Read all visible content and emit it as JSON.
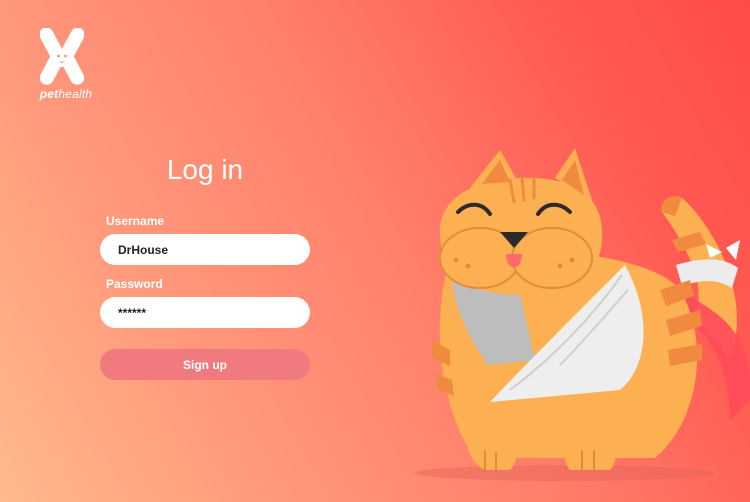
{
  "brand": {
    "name_part1": "pet",
    "name_part2": "health"
  },
  "login": {
    "title": "Log in",
    "username_label": "Username",
    "username_value": "DrHouse",
    "password_label": "Password",
    "password_value": "******",
    "submit_label": "Sign up"
  },
  "colors": {
    "accent_button": "#f07a7d",
    "gradient_start": "#ffb98a",
    "gradient_end": "#ff4a4a",
    "cat_orange": "#fcb052",
    "cat_stripe": "#f08a3f"
  },
  "illustration": {
    "subject": "cat-with-sling-illustration"
  }
}
